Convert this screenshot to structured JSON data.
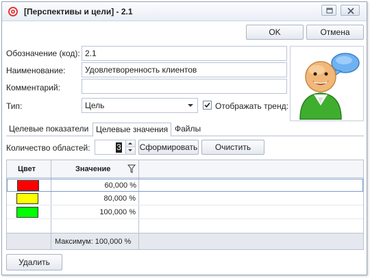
{
  "window": {
    "title": "[Перспективы и цели] - 2.1"
  },
  "actions": {
    "ok_label": "OK",
    "cancel_label": "Отмена",
    "delete_label": "Удалить"
  },
  "form": {
    "code_label": "Обозначение (код):",
    "code_value": "2.1",
    "name_label": "Наименование:",
    "name_value": "Удовлетворенность клиентов",
    "comment_label": "Комментарий:",
    "comment_value": "",
    "type_label": "Тип:",
    "type_value": "Цель",
    "show_trend_label": "Отображать тренд:",
    "show_trend_checked": true
  },
  "tabs": [
    {
      "label": "Целевые показатели",
      "active": false
    },
    {
      "label": "Целевые значения",
      "active": true
    },
    {
      "label": "Файлы",
      "active": false
    }
  ],
  "target_values": {
    "areas_label": "Количество областей:",
    "areas_value": "3",
    "generate_label": "Сформировать",
    "clear_label": "Очистить",
    "columns": {
      "color": "Цвет",
      "value": "Значение"
    },
    "rows": [
      {
        "color": "#ff0000",
        "value": "60,000 %"
      },
      {
        "color": "#ffff00",
        "value": "80,000 %"
      },
      {
        "color": "#00ff00",
        "value": "100,000 %"
      }
    ],
    "footer_max": "Максимум: 100,000 %"
  },
  "icons": {
    "app": "target-icon",
    "restore": "restore-icon",
    "close": "close-icon",
    "filter": "filter-icon",
    "avatar": "user-speech-bubble-icon"
  }
}
